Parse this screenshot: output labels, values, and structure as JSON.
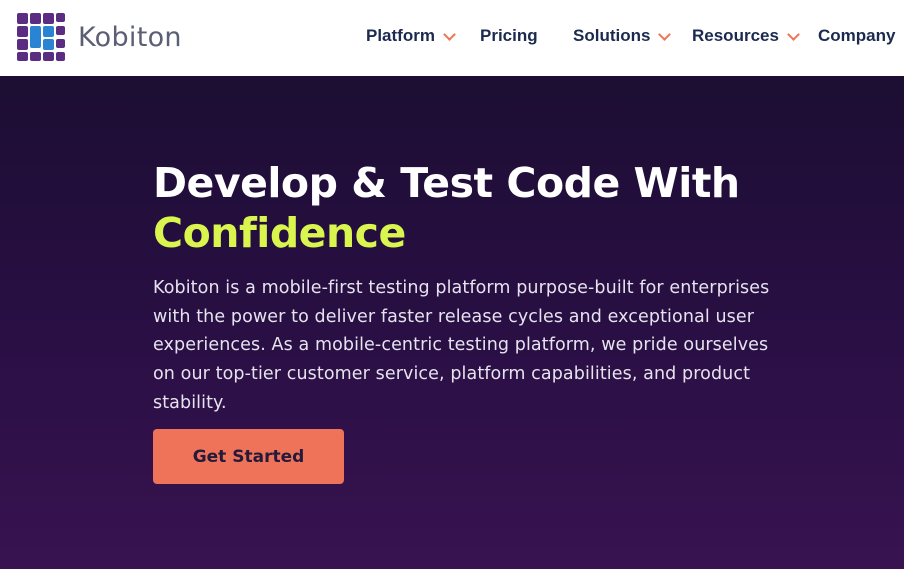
{
  "brand": {
    "name": "Kobiton",
    "logo_icon": "kobiton-logo-icon",
    "colors": {
      "purple": "#5a2d82",
      "blue": "#2b83d4",
      "text": "#5a5f73"
    }
  },
  "nav": {
    "items": [
      {
        "label": "Platform",
        "has_dropdown": true
      },
      {
        "label": "Pricing",
        "has_dropdown": false
      },
      {
        "label": "Solutions",
        "has_dropdown": true
      },
      {
        "label": "Resources",
        "has_dropdown": true
      },
      {
        "label": "Company",
        "has_dropdown": false
      }
    ],
    "dropdown_icon": "chevron-down-icon",
    "accent_color": "#ef7357"
  },
  "hero": {
    "title_line1": "Develop & Test Code With",
    "title_accent": "Confidence",
    "description": "Kobiton is a mobile-first testing platform purpose-built for enterprises with the power to deliver faster release cycles and exceptional user experiences. As a mobile-centric testing platform, we pride ourselves on our top-tier customer service, platform capabilities, and product stability.",
    "cta_label": "Get Started",
    "colors": {
      "background": "#241040",
      "accent": "#d9f54e",
      "cta": "#ef7359"
    }
  }
}
